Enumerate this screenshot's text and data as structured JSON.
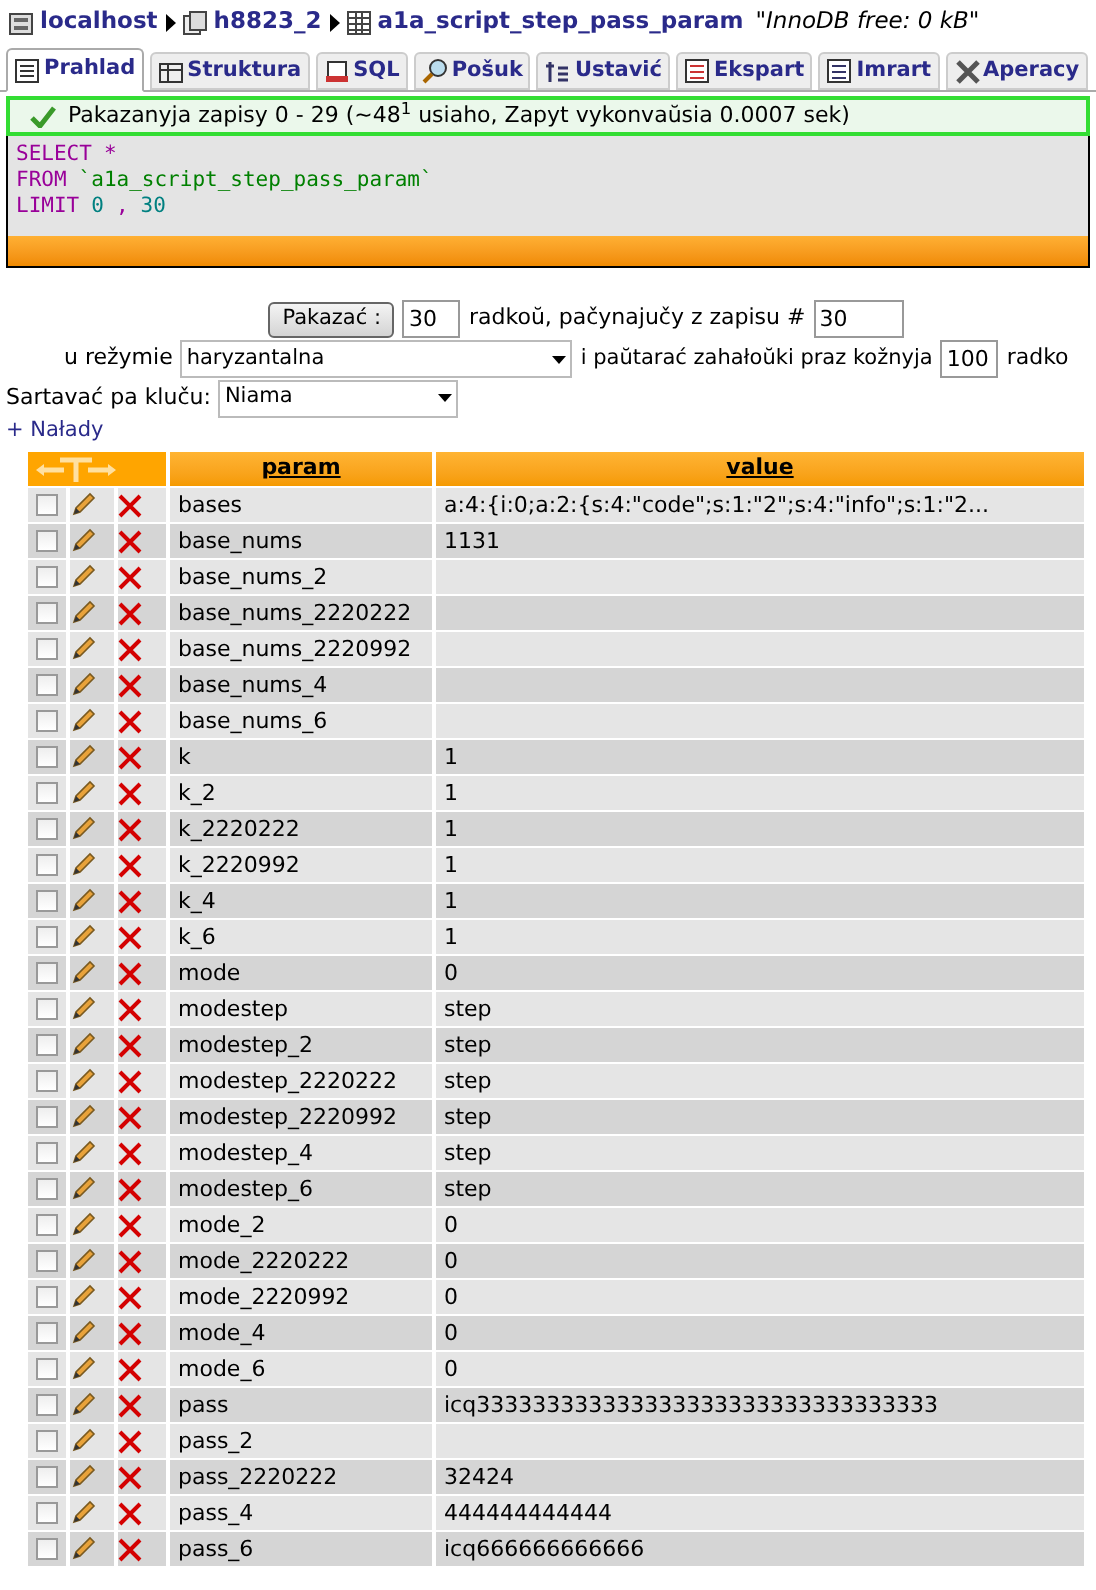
{
  "breadcrumb": [
    {
      "kind": "server",
      "label": "localhost"
    },
    {
      "kind": "database",
      "label": "h8823_2"
    },
    {
      "kind": "table",
      "label": "a1a_script_step_pass_param"
    }
  ],
  "table_comment": "\"InnoDB free: 0 kB\"",
  "tabs": [
    {
      "label": "Prahlad",
      "kind": "browse",
      "selected": true
    },
    {
      "label": "Struktura",
      "kind": "structure",
      "selected": false
    },
    {
      "label": "SQL",
      "kind": "sql",
      "selected": false
    },
    {
      "label": "Pošuk",
      "kind": "search",
      "selected": false
    },
    {
      "label": "Ustavić",
      "kind": "insert",
      "selected": false
    },
    {
      "label": "Ekspart",
      "kind": "export",
      "selected": false
    },
    {
      "label": "Imrart",
      "kind": "import",
      "selected": false
    },
    {
      "label": "Aperacy",
      "kind": "operations",
      "selected": false
    }
  ],
  "message": "Pakazanyja zapisy 0 - 29 (~48$^{1}$ usiaho, Zapyt vykonvaŭsia 0.0007 sek)",
  "sql": [
    [
      {
        "kind": "keyword",
        "text": "SELECT"
      },
      {
        "kind": "operator",
        "text": "*"
      }
    ],
    [
      {
        "kind": "keyword",
        "text": "FROM"
      },
      {
        "kind": "string",
        "text": "`a1a_script_step_pass_param`"
      }
    ],
    [
      {
        "kind": "keyword",
        "text": "LIMIT"
      },
      {
        "kind": "number",
        "text": "0"
      },
      {
        "kind": "operator",
        "text": ","
      },
      {
        "kind": "number",
        "text": "30"
      }
    ]
  ],
  "navigation": {
    "show_button": "Pakazać :",
    "rows_value": "30",
    "rows_label": "radkoŭ, pačynajučy z zapisu #",
    "start_value": "30",
    "mode_label": "u režymie",
    "mode_value": "haryzantalna",
    "repeat_label": "i paŭtarać zahałoŭki praz kožnyja",
    "repeat_value": "100",
    "repeat_suffix": "radko",
    "sort_label": "Sartavać pa kluču:",
    "sort_value": "Niama",
    "options_link": "+ Nałady"
  },
  "table": {
    "columns": [
      "param",
      "value"
    ],
    "rows": [
      {
        "param": "bases",
        "checked": false,
        "value": "a:4:{i:0;a:2:{s:4:\"code\";s:1:\"2\";s:4:\"info\";s:1:\"2..."
      },
      {
        "param": "base_nums",
        "checked": false,
        "value": "1131"
      },
      {
        "param": "base_nums_2",
        "checked": false
      },
      {
        "param": "base_nums_2220222",
        "checked": false
      },
      {
        "param": "base_nums_2220992",
        "checked": false
      },
      {
        "param": "base_nums_4",
        "checked": false
      },
      {
        "param": "base_nums_6",
        "checked": false
      },
      {
        "param": "k",
        "checked": false,
        "value": "1"
      },
      {
        "param": "k_2",
        "checked": false,
        "value": "1"
      },
      {
        "param": "k_2220222",
        "checked": false,
        "value": "1"
      },
      {
        "param": "k_2220992",
        "checked": false,
        "value": "1"
      },
      {
        "param": "k_4",
        "checked": false,
        "value": "1"
      },
      {
        "param": "k_6",
        "checked": false,
        "value": "1"
      },
      {
        "param": "mode",
        "checked": false,
        "value": "0"
      },
      {
        "param": "modestep",
        "checked": false,
        "value": "step"
      },
      {
        "param": "modestep_2",
        "checked": false,
        "value": "step"
      },
      {
        "param": "modestep_2220222",
        "checked": false,
        "value": "step"
      },
      {
        "param": "modestep_2220992",
        "checked": false,
        "value": "step"
      },
      {
        "param": "modestep_4",
        "checked": false,
        "value": "step"
      },
      {
        "param": "modestep_6",
        "checked": false,
        "value": "step"
      },
      {
        "param": "mode_2",
        "checked": false,
        "value": "0"
      },
      {
        "param": "mode_2220222",
        "checked": false,
        "value": "0"
      },
      {
        "param": "mode_2220992",
        "checked": false,
        "value": "0"
      },
      {
        "param": "mode_4",
        "checked": false,
        "value": "0"
      },
      {
        "param": "mode_6",
        "checked": false,
        "value": "0"
      },
      {
        "param": "pass",
        "checked": false,
        "value": "icq333333333333333333333333333333333"
      },
      {
        "param": "pass_2",
        "checked": false
      },
      {
        "param": "pass_2220222",
        "checked": false,
        "value": "32424"
      },
      {
        "param": "pass_4",
        "checked": false,
        "value": "444444444444"
      },
      {
        "param": "pass_6",
        "checked": false,
        "value": "icq666666666666"
      }
    ]
  }
}
